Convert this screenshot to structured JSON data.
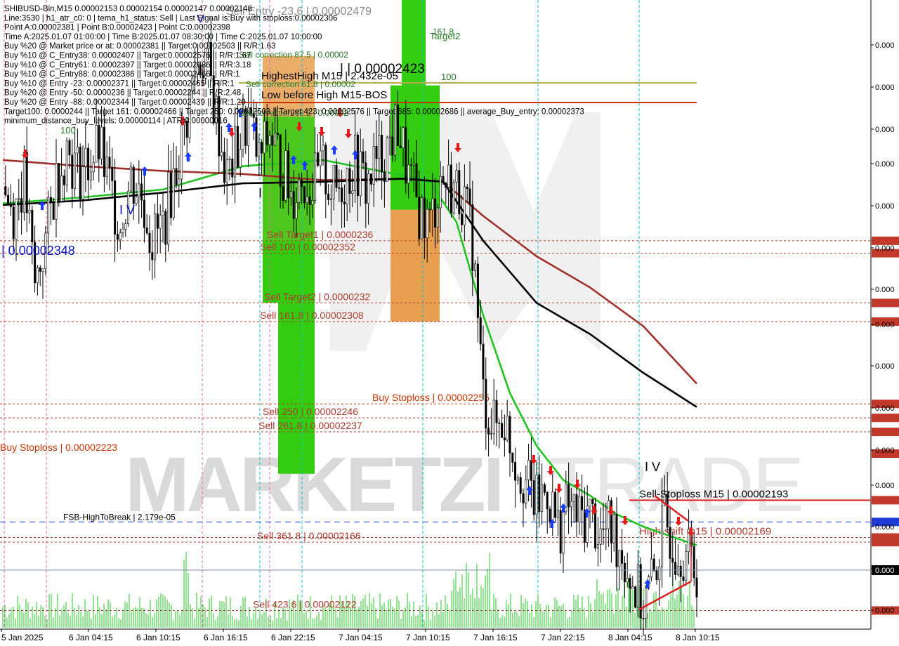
{
  "header": {
    "lines": [
      "SHIBUSD-Bin,M15  0.00002153 0.00002154 0.00002147 0.00002148",
      "Line:3530 | h1_atr_c0: 0 | tema_h1_status: Sell | Last Signal is:Buy with stoploss:0.00002306",
      "Point A:0.00002381 | Point B:0.00002423 | Point C:0.00002398",
      "Time A:2025.01.07 01:00:00 | Time B:2025.01.07 08:30:00 | Time C:2025.01.07 10:00:00",
      "Buy %20 @ Market price or at: 0.00002381 || Target:0.00002503 || R/R:1.63",
      "Buy %10 @ C_Entry38: 0.00002407 || Target:0.00002576 || R/R:1.67",
      "Buy %10 @ C_Entry61: 0.00002397 || Target:0.00002686 || R/R:3.18",
      "Buy %10 @ C_Entry88: 0.00002386 || Target:0.00002466 || R/R:1",
      "Buy %10 @ Entry -23: 0.00002371 || Target:0.00002465 || R/R:1",
      "Buy %20 @ Entry -50: 0.0000236 || Target:0.00002244 || R/R:2.48",
      "Buy %20 @ Entry -88: 0.00002344 || Target:0.00002439 || R/R:1.29",
      "Target100: 0.0000244 || Target 161: 0.00002466 || Target 250: 0.00002503 || Target 423: 0.00002576 || Target 685: 0.00002686 || average_Buy_entry: 0.00002373",
      "minimum_distance_buy_levels: 0.00000114 | ATR:0.00000016"
    ]
  },
  "watermark": {
    "bold": "MARKETZI",
    "light": "TRADE"
  },
  "colors": {
    "up_candle": "#000000",
    "down_candle": "#000000",
    "ma_green": "#22c422",
    "ma_brown": "#a0302a",
    "ma_black": "#000000",
    "sell_level": "#b03a2e",
    "buy_level": "#cc3300",
    "stoploss_line": "#e02020",
    "fsb_line": "#1f3bd6",
    "cyan_vline": "#00c8d6",
    "pink_vline": "#ee66aa",
    "green_zone": "#33cc11",
    "orange_zone": "#e8a050",
    "volume": "#22cc22"
  },
  "chart_data": {
    "type": "candlestick",
    "symbol": "SHIBUSD-Bin",
    "timeframe": "M15",
    "x_labels": [
      "5 Jan 2025",
      "6 Jan 04:15",
      "6 Jan 10:15",
      "6 Jan 16:15",
      "6 Jan 22:15",
      "7 Jan 04:15",
      "7 Jan 10:15",
      "7 Jan 16:15",
      "7 Jan 22:15",
      "8 Jan 04:15",
      "8 Jan 10:15"
    ],
    "ylim": [
      2.11e-05,
      2.515e-05
    ],
    "grid": false,
    "last_price": 2.148e-05,
    "right_axis_tags": [
      "0.000",
      "0.000",
      "0.000",
      "0.000",
      "0.000",
      "0.000",
      "0.000",
      "0.000",
      "0.000",
      "0.000",
      "0.000",
      "0.000",
      "0.000",
      "0.000",
      "0.000",
      "0.000",
      "0.000",
      "0.000",
      "0.000"
    ],
    "close_path": [
      [
        0,
        2.395e-05
      ],
      [
        4,
        2.38e-05
      ],
      [
        8,
        2.4e-05
      ],
      [
        12,
        2.33e-05
      ],
      [
        16,
        2.36e-05
      ],
      [
        20,
        2.4e-05
      ],
      [
        24,
        2.42e-05
      ],
      [
        28,
        2.405e-05
      ],
      [
        32,
        2.41e-05
      ],
      [
        36,
        2.42e-05
      ],
      [
        40,
        2.395e-05
      ],
      [
        44,
        2.37e-05
      ],
      [
        48,
        2.4e-05
      ],
      [
        52,
        2.39e-05
      ],
      [
        56,
        2.36e-05
      ],
      [
        60,
        2.37e-05
      ],
      [
        64,
        2.4e-05
      ],
      [
        68,
        2.43e-05
      ],
      [
        72,
        2.47e-05
      ],
      [
        76,
        2.48e-05
      ],
      [
        80,
        2.44e-05
      ],
      [
        84,
        2.4e-05
      ],
      [
        88,
        2.42e-05
      ],
      [
        92,
        2.44e-05
      ],
      [
        96,
        2.41e-05
      ],
      [
        100,
        2.43e-05
      ],
      [
        104,
        2.41e-05
      ],
      [
        108,
        2.39e-05
      ],
      [
        112,
        2.4e-05
      ],
      [
        116,
        2.395e-05
      ],
      [
        120,
        2.405e-05
      ],
      [
        124,
        2.39e-05
      ],
      [
        128,
        2.4e-05
      ],
      [
        132,
        2.41e-05
      ],
      [
        136,
        2.395e-05
      ],
      [
        140,
        2.41e-05
      ],
      [
        144,
        2.42e-05
      ],
      [
        148,
        2.435e-05
      ],
      [
        152,
        2.4e-05
      ],
      [
        156,
        2.38e-05
      ],
      [
        160,
        2.37e-05
      ],
      [
        164,
        2.4e-05
      ],
      [
        168,
        2.395e-05
      ],
      [
        172,
        2.39e-05
      ],
      [
        176,
        2.36e-05
      ],
      [
        180,
        2.26e-05
      ],
      [
        184,
        2.24e-05
      ],
      [
        188,
        2.245e-05
      ],
      [
        192,
        2.22e-05
      ],
      [
        196,
        2.205e-05
      ],
      [
        200,
        2.19e-05
      ],
      [
        204,
        2.2e-05
      ],
      [
        208,
        2.175e-05
      ],
      [
        212,
        2.19e-05
      ],
      [
        216,
        2.18e-05
      ],
      [
        220,
        2.185e-05
      ],
      [
        224,
        2.17e-05
      ],
      [
        228,
        2.175e-05
      ],
      [
        232,
        2.16e-05
      ],
      [
        236,
        2.14e-05
      ],
      [
        240,
        2.125e-05
      ],
      [
        244,
        2.145e-05
      ],
      [
        248,
        2.18e-05
      ],
      [
        252,
        2.165e-05
      ],
      [
        256,
        2.16e-05
      ],
      [
        260,
        2.148e-05
      ]
    ],
    "moving_averages": [
      {
        "color_key": "ma_green",
        "points": [
          [
            0,
            2.384e-05
          ],
          [
            30,
            2.388e-05
          ],
          [
            60,
            2.393e-05
          ],
          [
            90,
            2.408e-05
          ],
          [
            120,
            2.412e-05
          ],
          [
            150,
            2.402e-05
          ],
          [
            160,
            2.398e-05
          ],
          [
            170,
            2.372e-05
          ],
          [
            180,
            2.312e-05
          ],
          [
            190,
            2.262e-05
          ],
          [
            200,
            2.228e-05
          ],
          [
            210,
            2.206e-05
          ],
          [
            220,
            2.196e-05
          ],
          [
            230,
            2.184e-05
          ],
          [
            240,
            2.176e-05
          ],
          [
            250,
            2.17e-05
          ],
          [
            260,
            2.164e-05
          ]
        ]
      },
      {
        "color_key": "ma_brown",
        "points": [
          [
            0,
            2.412e-05
          ],
          [
            30,
            2.408e-05
          ],
          [
            60,
            2.405e-05
          ],
          [
            90,
            2.403e-05
          ],
          [
            120,
            2.399e-05
          ],
          [
            150,
            2.4e-05
          ],
          [
            165,
            2.398e-05
          ],
          [
            180,
            2.376e-05
          ],
          [
            200,
            2.35e-05
          ],
          [
            220,
            2.33e-05
          ],
          [
            240,
            2.305e-05
          ],
          [
            260,
            2.268e-05
          ]
        ]
      },
      {
        "color_key": "ma_black",
        "points": [
          [
            0,
            2.383e-05
          ],
          [
            30,
            2.386e-05
          ],
          [
            60,
            2.391e-05
          ],
          [
            90,
            2.397e-05
          ],
          [
            120,
            2.398e-05
          ],
          [
            150,
            2.4e-05
          ],
          [
            165,
            2.398e-05
          ],
          [
            180,
            2.36e-05
          ],
          [
            200,
            2.32e-05
          ],
          [
            220,
            2.3e-05
          ],
          [
            240,
            2.275e-05
          ],
          [
            260,
            2.253e-05
          ]
        ]
      }
    ]
  },
  "levels": [
    {
      "label": "Sell Target1 | 0.0000236",
      "value": 2.36e-05,
      "color_key": "sell_level"
    },
    {
      "label": "Sell 100 | 0.00002352",
      "value": 2.352e-05,
      "color_key": "sell_level"
    },
    {
      "label": "Sell Target2 | 0.0000232",
      "value": 2.32e-05,
      "color_key": "sell_level"
    },
    {
      "label": "Sell 161.8 | 0.00002308",
      "value": 2.308e-05,
      "color_key": "sell_level"
    },
    {
      "label": "Buy Stoploss | 0.00002255",
      "value": 2.255e-05,
      "color_key": "buy_level"
    },
    {
      "label": "Sell  250 | 0.00002246",
      "value": 2.246e-05,
      "color_key": "sell_level"
    },
    {
      "label": "Sell  261.8 | 0.00002237",
      "value": 2.237e-05,
      "color_key": "sell_level"
    },
    {
      "label": "Buy Stoploss | 0.00002223",
      "value": 2.223e-05,
      "color_key": "buy_level"
    },
    {
      "label": "Sell-Stoploss M15 | 0.00002193",
      "value": 2.193e-05,
      "color_key": "stoploss_line"
    },
    {
      "label": "FSB-HighToBreak | 2.179e-05",
      "value": 2.179e-05,
      "color_key": "fsb_line"
    },
    {
      "label": "High-shift m15 | 0.00002169",
      "value": 2.169e-05,
      "color_key": "sell_level"
    },
    {
      "label": "Sell  361.8 | 0.00002166",
      "value": 2.166e-05,
      "color_key": "sell_level"
    },
    {
      "label": "Sell  423.6 | 0.00002122",
      "value": 2.122e-05,
      "color_key": "sell_level"
    }
  ],
  "annotations": {
    "highest_high": "HighestHigh   M15 | 2.432e-05",
    "low_before_high": "Low before High   M15-BOS",
    "big_price": "| | 0.00002423",
    "left_price": "| 0.00002348",
    "sell_entry": "Sell Entry -23.6 | 0.00002479",
    "sell_corr_875": "Sell correction 87.5 | 0.00002",
    "sell_corr_618": "Sell correction 61.8 | 0.00002",
    "sell_corr_382": "Sell correction 38.2 | 0.00002",
    "sell_100_top": "Sell 100",
    "target2": "Target2",
    "fib_1618": "161.8",
    "label_100_green": "100",
    "label_100_left": "100",
    "wave_iv_left": "I V",
    "wave_iv_right": "I V",
    "wave_i": "I",
    "wave_v_top": "V"
  }
}
